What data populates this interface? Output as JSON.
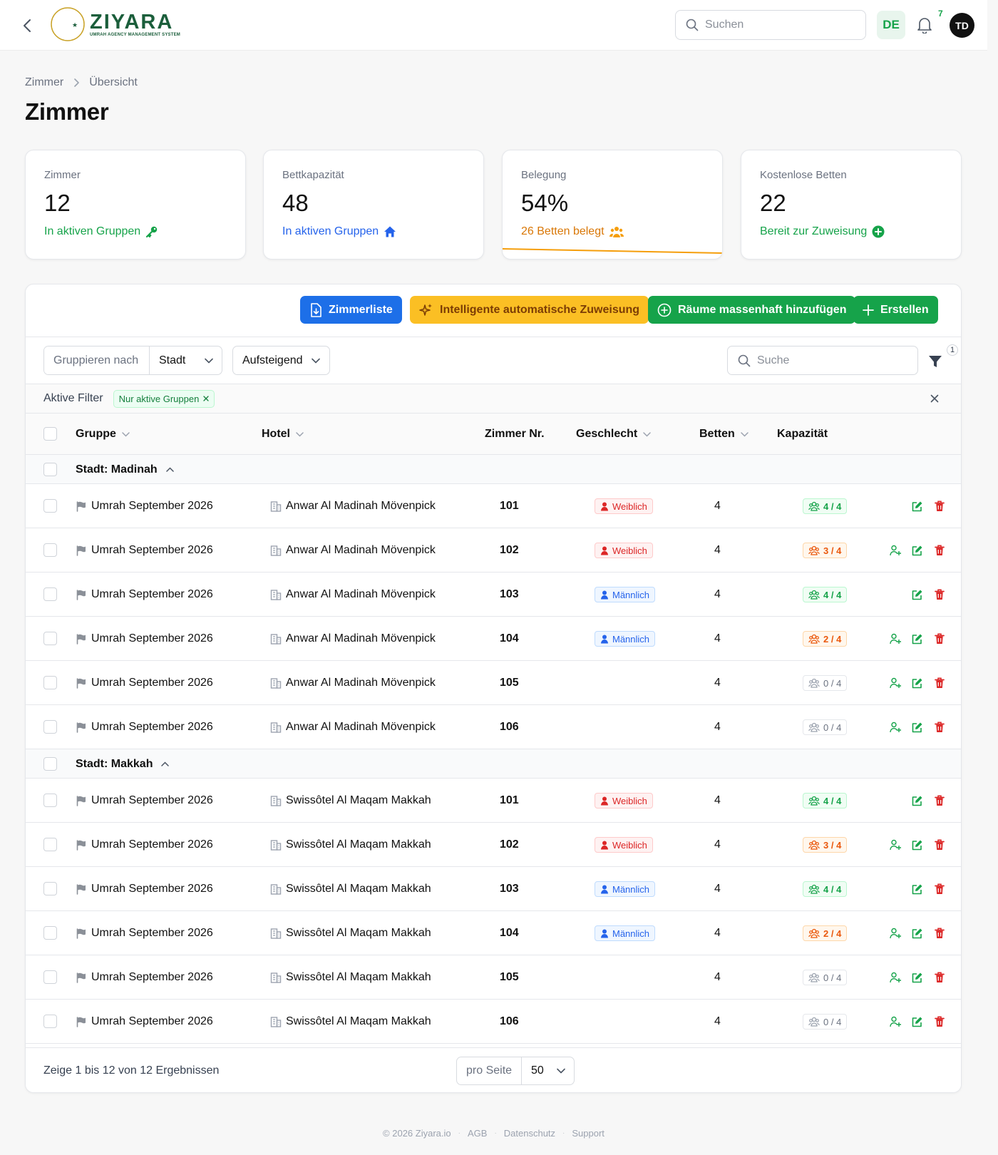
{
  "header": {
    "logo_title": "ZIYARA",
    "logo_subtitle": "UMRAH AGENCY MANAGEMENT SYSTEM",
    "search_placeholder": "Suchen",
    "language": "DE",
    "notification_count": "7",
    "avatar_initials": "TD"
  },
  "breadcrumb": {
    "parent": "Zimmer",
    "current": "Übersicht"
  },
  "page_title": "Zimmer",
  "stats": [
    {
      "label": "Zimmer",
      "value": "12",
      "sub": "In aktiven Gruppen",
      "icon": "key-icon",
      "color": "#16a34a"
    },
    {
      "label": "Bettkapazität",
      "value": "48",
      "sub": "In aktiven Gruppen",
      "icon": "home-icon",
      "color": "#2563eb"
    },
    {
      "label": "Belegung",
      "value": "54%",
      "sub": "26 Betten belegt",
      "icon": "users-icon",
      "color": "#d97706",
      "progress": 0.54
    },
    {
      "label": "Kostenlose Betten",
      "value": "22",
      "sub": "Bereit zur Zuweisung",
      "icon": "plus-circle-icon",
      "color": "#16a34a"
    }
  ],
  "toolbar": {
    "room_list": "Zimmerliste",
    "auto_assign": "Intelligente automatische Zuweisung",
    "bulk_add": "Räume massenhaft hinzufügen",
    "create": "Erstellen"
  },
  "controls": {
    "group_by_label": "Gruppieren nach",
    "group_by_value": "Stadt",
    "order_value": "Aufsteigend",
    "search_placeholder": "Suche",
    "filter_count": "1"
  },
  "active_filters": {
    "label": "Aktive Filter",
    "chip": "Nur aktive Gruppen"
  },
  "columns": {
    "group": "Gruppe",
    "hotel": "Hotel",
    "room_no": "Zimmer Nr.",
    "gender": "Geschlecht",
    "beds": "Betten",
    "capacity": "Kapazität"
  },
  "groups": [
    {
      "label": "Stadt: Madinah",
      "rows": [
        {
          "group": "Umrah September 2026",
          "hotel": "Anwar Al Madinah Mövenpick",
          "room": "101",
          "gender": "Weiblich",
          "beds": "4",
          "capacity": "4 / 4"
        },
        {
          "group": "Umrah September 2026",
          "hotel": "Anwar Al Madinah Mövenpick",
          "room": "102",
          "gender": "Weiblich",
          "beds": "4",
          "capacity": "3 / 4"
        },
        {
          "group": "Umrah September 2026",
          "hotel": "Anwar Al Madinah Mövenpick",
          "room": "103",
          "gender": "Männlich",
          "beds": "4",
          "capacity": "4 / 4"
        },
        {
          "group": "Umrah September 2026",
          "hotel": "Anwar Al Madinah Mövenpick",
          "room": "104",
          "gender": "Männlich",
          "beds": "4",
          "capacity": "2 / 4"
        },
        {
          "group": "Umrah September 2026",
          "hotel": "Anwar Al Madinah Mövenpick",
          "room": "105",
          "gender": "",
          "beds": "4",
          "capacity": "0 / 4"
        },
        {
          "group": "Umrah September 2026",
          "hotel": "Anwar Al Madinah Mövenpick",
          "room": "106",
          "gender": "",
          "beds": "4",
          "capacity": "0 / 4"
        }
      ]
    },
    {
      "label": "Stadt: Makkah",
      "rows": [
        {
          "group": "Umrah September 2026",
          "hotel": "Swissôtel Al Maqam Makkah",
          "room": "101",
          "gender": "Weiblich",
          "beds": "4",
          "capacity": "4 / 4"
        },
        {
          "group": "Umrah September 2026",
          "hotel": "Swissôtel Al Maqam Makkah",
          "room": "102",
          "gender": "Weiblich",
          "beds": "4",
          "capacity": "3 / 4"
        },
        {
          "group": "Umrah September 2026",
          "hotel": "Swissôtel Al Maqam Makkah",
          "room": "103",
          "gender": "Männlich",
          "beds": "4",
          "capacity": "4 / 4"
        },
        {
          "group": "Umrah September 2026",
          "hotel": "Swissôtel Al Maqam Makkah",
          "room": "104",
          "gender": "Männlich",
          "beds": "4",
          "capacity": "2 / 4"
        },
        {
          "group": "Umrah September 2026",
          "hotel": "Swissôtel Al Maqam Makkah",
          "room": "105",
          "gender": "",
          "beds": "4",
          "capacity": "0 / 4"
        },
        {
          "group": "Umrah September 2026",
          "hotel": "Swissôtel Al Maqam Makkah",
          "room": "106",
          "gender": "",
          "beds": "4",
          "capacity": "0 / 4"
        }
      ]
    }
  ],
  "pagination": {
    "results": "Zeige 1 bis 12 von 12 Ergebnissen",
    "per_page_label": "pro Seite",
    "per_page_value": "50"
  },
  "footer": {
    "copyright": "© 2026 Ziyara.io",
    "links": [
      "AGB",
      "Datenschutz",
      "Support"
    ]
  }
}
